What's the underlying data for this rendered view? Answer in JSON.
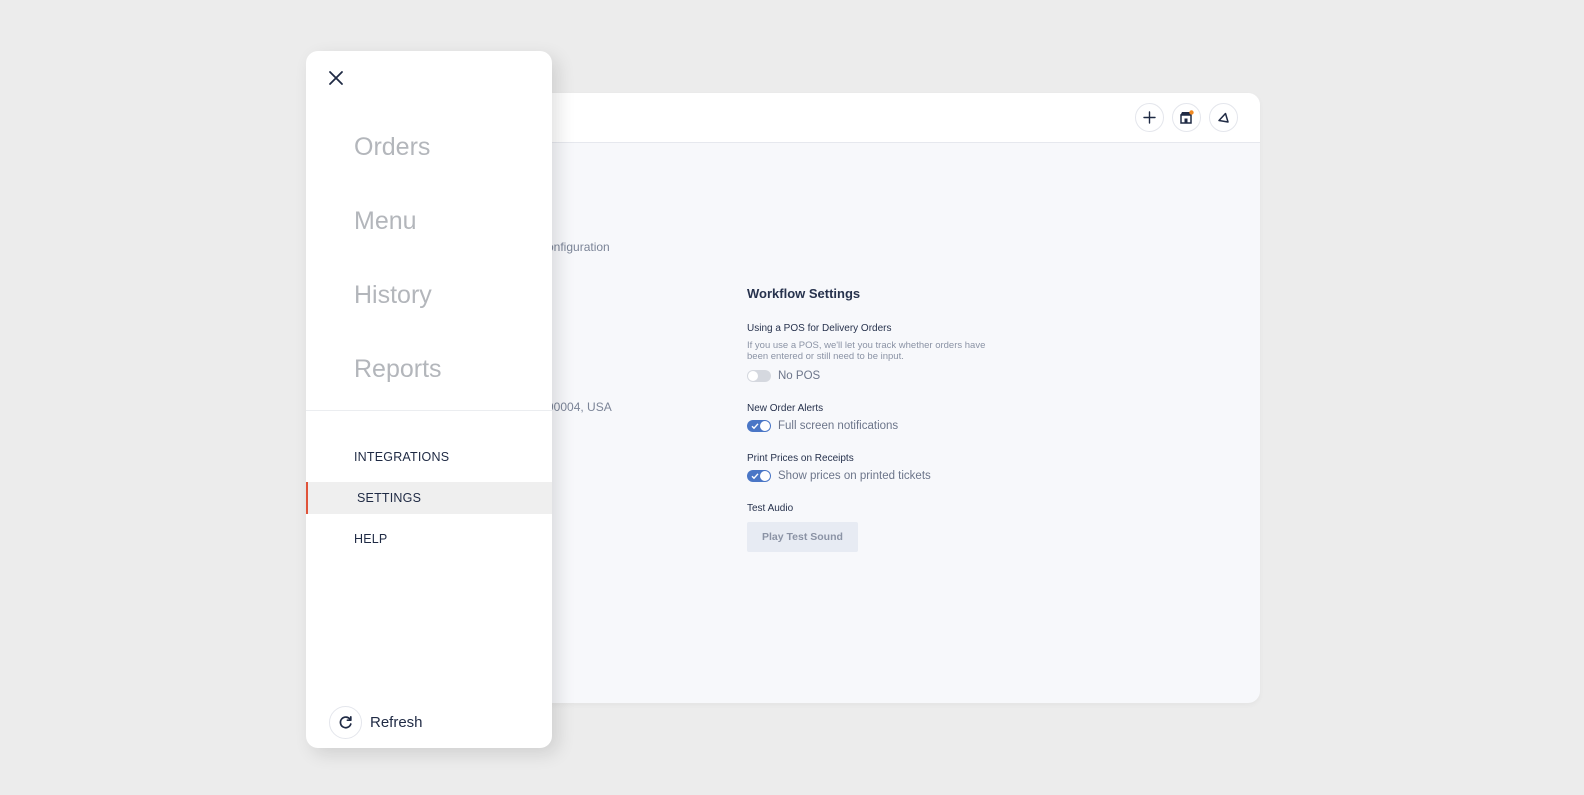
{
  "background_app": {
    "header_actions": [
      {
        "icon": "plus-icon"
      },
      {
        "icon": "store-icon",
        "badge_color": "#f08a24"
      },
      {
        "icon": "bell-icon"
      }
    ],
    "fragment_configuration": "onfiguration",
    "fragment_address": "90004, USA",
    "workflow": {
      "title": "Workflow Settings",
      "pos": {
        "label": "Using a POS for Delivery Orders",
        "description": "If you use a POS, we'll let you track whether orders have been entered or still need to be input.",
        "toggle_state": "off",
        "toggle_text": "No POS"
      },
      "alerts": {
        "label": "New Order Alerts",
        "toggle_state": "on",
        "toggle_text": "Full screen notifications"
      },
      "prices": {
        "label": "Print Prices on Receipts",
        "toggle_state": "on",
        "toggle_text": "Show prices on printed tickets"
      },
      "audio": {
        "label": "Test Audio",
        "button_label": "Play Test Sound"
      }
    }
  },
  "drawer": {
    "close_icon": "close-icon",
    "primary_nav": [
      "Orders",
      "Menu",
      "History",
      "Reports"
    ],
    "secondary_nav": [
      "INTEGRATIONS",
      "SETTINGS",
      "HELP"
    ],
    "active_item": "SETTINGS",
    "refresh_label": "Refresh",
    "accent_color": "#e0533a"
  }
}
